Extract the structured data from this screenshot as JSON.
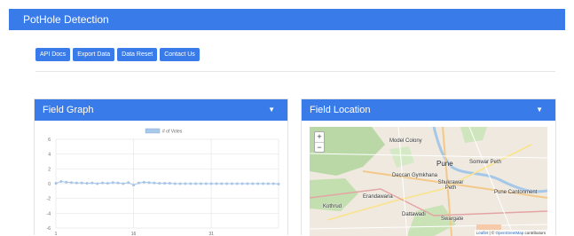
{
  "navbar": {
    "title": "PotHole Detection"
  },
  "buttons": [
    "API Docs",
    "Export Data",
    "Data Reset",
    "Contact Us"
  ],
  "graph_card": {
    "title": "Field Graph",
    "caret": "▼"
  },
  "location_card": {
    "title": "Field Location",
    "caret": "▼"
  },
  "chart_data": {
    "type": "line",
    "title": "",
    "legend": [
      "# of Votes"
    ],
    "legend_position": "top",
    "ylim": [
      -6,
      6
    ],
    "yticks": [
      6,
      4,
      2,
      0,
      -2,
      -4,
      -6
    ],
    "xtick_labels": [
      {
        "x": 1,
        "label": "1"
      },
      {
        "x": 16,
        "label": "16"
      },
      {
        "x": 31,
        "label": "31"
      }
    ],
    "grid": true,
    "series": [
      {
        "name": "# of Votes",
        "x": [
          1,
          2,
          3,
          4,
          5,
          6,
          7,
          8,
          9,
          10,
          11,
          12,
          13,
          14,
          15,
          16,
          17,
          18,
          19,
          20,
          21,
          22,
          23,
          24,
          25,
          26,
          27,
          28,
          29,
          30,
          31,
          32,
          33,
          34,
          35,
          36,
          37,
          38,
          39,
          40,
          41,
          42,
          43,
          44
        ],
        "values": [
          0.05,
          0.3,
          0.2,
          0.15,
          0.1,
          0.1,
          0.05,
          0.1,
          0.0,
          0.1,
          0.05,
          0.15,
          0.1,
          0.0,
          0.15,
          -0.2,
          0.1,
          0.2,
          0.15,
          0.1,
          0.05,
          0.05,
          0.05,
          0.0,
          0.0,
          0.0,
          0.0,
          0.0,
          0.0,
          0.0,
          0.0,
          0.0,
          0.0,
          0.0,
          0.0,
          0.0,
          0.0,
          0.0,
          0.0,
          0.0,
          0.0,
          0.0,
          0.0,
          -0.05
        ],
        "color": "#a9c8ea"
      }
    ]
  },
  "map": {
    "zoom_in": "+",
    "zoom_out": "−",
    "attribution_leaflet": "Leaflet",
    "attribution_sep": " | © ",
    "attribution_osm": "OpenStreetMap",
    "attribution_tail": " contributors",
    "labels": [
      {
        "text": "Model Colony"
      },
      {
        "text": "Pune"
      },
      {
        "text": "Somwar Peth"
      },
      {
        "text": "Deccan Gymkhana"
      },
      {
        "text": "Shukrawar Peth"
      },
      {
        "text": "Pune Cantonment"
      },
      {
        "text": "Erandawana"
      },
      {
        "text": "Kothrud"
      },
      {
        "text": "Dattawadi"
      },
      {
        "text": "Swargate"
      }
    ]
  }
}
